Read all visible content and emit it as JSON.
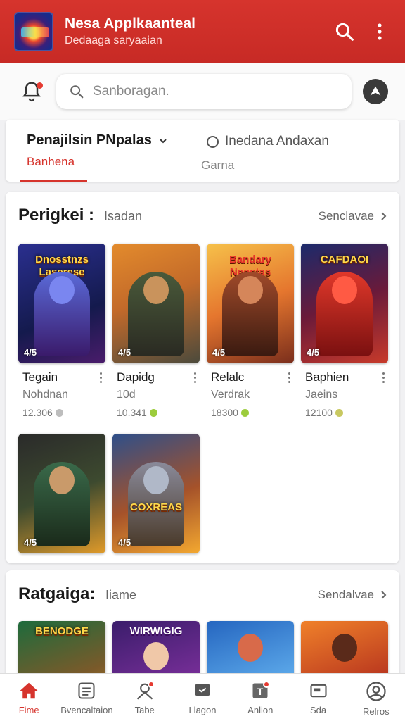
{
  "header": {
    "title": "Nesa Applkaanteal",
    "subtitle": "Dedaaga saryaaian",
    "search_icon": "search-icon",
    "menu_icon": "more-vert-icon"
  },
  "search": {
    "placeholder": "Sanboragan."
  },
  "tabs": [
    {
      "label": "Penajilsin PNpalas",
      "sublabel": "Banhena"
    },
    {
      "label": "Inedana Andaxan",
      "sublabel": "Garna"
    }
  ],
  "section1": {
    "title": "Perigkei :",
    "subtitle": "Isadan",
    "more": "Senclavae",
    "cards": [
      {
        "art": "Dnosstnzs Laserese",
        "badge": "4/5",
        "name": "Tegain",
        "dev": "Nohdnan",
        "count": "12.306",
        "dot": "#bdbdbd"
      },
      {
        "art": "",
        "badge": "4/5",
        "name": "Dapidg",
        "dev": "10d",
        "count": "10.341",
        "dot": "#9ccc3c"
      },
      {
        "art": "Bandary Neostas",
        "badge": "4/5",
        "name": "Relalc",
        "dev": "Verdrak",
        "count": "18300",
        "dot": "#9ccc3c"
      },
      {
        "art": "CAFDAOI",
        "badge": "4/5",
        "name": "Baphien",
        "dev": "Jaeins",
        "count": "12100",
        "dot": "#c8c860"
      },
      {
        "art": "",
        "badge": "4/5",
        "name": "",
        "dev": "",
        "count": "",
        "dot": ""
      },
      {
        "art": "COXREAS",
        "badge": "4/5",
        "name": "",
        "dev": "",
        "count": "",
        "dot": ""
      }
    ]
  },
  "section2": {
    "title": "Ratgaiga:",
    "subtitle": "Iiame",
    "more": "Sendalvae",
    "cards": [
      {
        "art": "BENODGE"
      },
      {
        "art": "WIRWIGIG"
      },
      {
        "art": ""
      },
      {
        "art": ""
      }
    ]
  },
  "nav": [
    {
      "label": "Fime",
      "icon": "home-icon",
      "active": true
    },
    {
      "label": "Bvencaltaion",
      "icon": "list-icon"
    },
    {
      "label": "Tabe",
      "icon": "profile-icon"
    },
    {
      "label": "Llagon",
      "icon": "chat-icon"
    },
    {
      "label": "Anlion",
      "icon": "tag-icon"
    },
    {
      "label": "Sda",
      "icon": "store-icon"
    },
    {
      "label": "Relros",
      "icon": "account-icon"
    }
  ],
  "colors": {
    "primary": "#d6342d",
    "active_nav": "#d6342d"
  }
}
